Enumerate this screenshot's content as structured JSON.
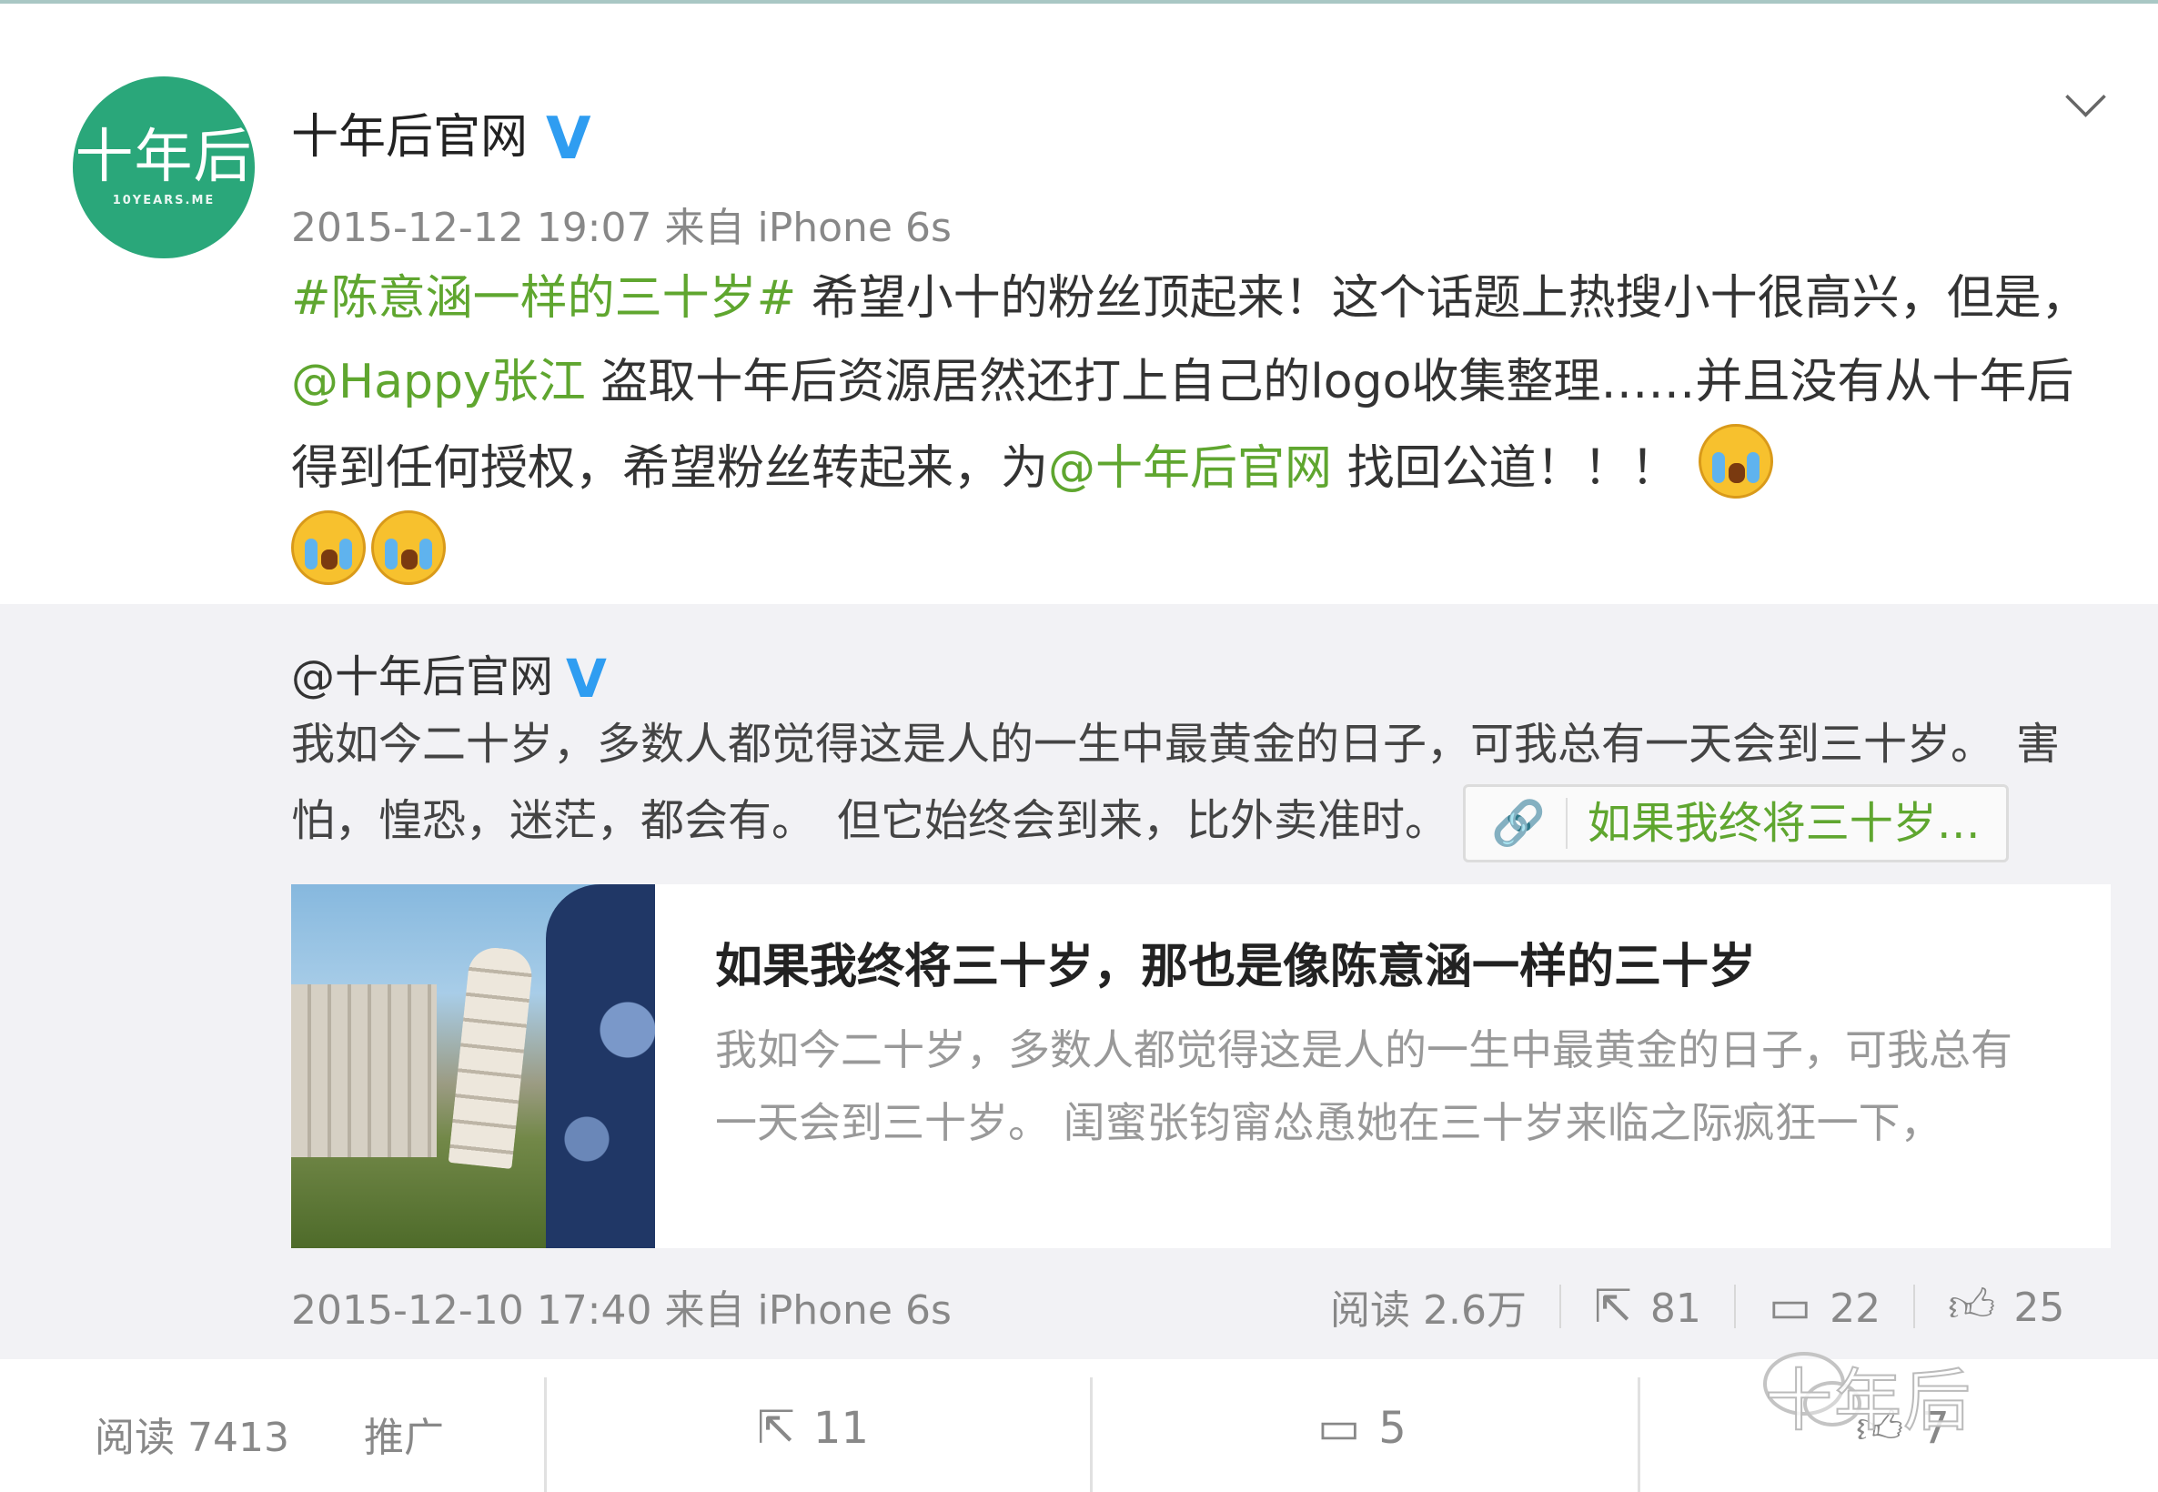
{
  "post": {
    "avatar_text": "十年后",
    "avatar_sub": "10YEARS.ME",
    "username": "十年后官网",
    "verified_mark": "V",
    "time": "2015-12-12 19:07",
    "source": "来自 iPhone 6s",
    "topic": "#陈意涵一样的三十岁#",
    "text_1": " 希望小十的粉丝顶起来！这个话题上热搜小十很高兴，但是，",
    "mention_1": "@Happy张江",
    "text_2": " 盗取十年后资源居然还打上自己的logo收集整理……并且没有从十年后得到任何授权，希望粉丝转起来，为",
    "mention_2": "@十年后官网",
    "text_3": " 找回公道！！！"
  },
  "repost": {
    "username": "@十年后官网",
    "verified_mark": "V",
    "text": "我如今二十岁，多数人都觉得这是人的一生中最黄金的日子，可我总有一天会到三十岁。　害怕，惶恐，迷茫，都会有。　但它始终会到来，比外卖准时。",
    "link_icon": "🔗",
    "link_label": "如果我终将三十岁…",
    "article_title": "如果我终将三十岁，那也是像陈意涵一样的三十岁",
    "article_desc": "我如今二十岁，多数人都觉得这是人的一生中最黄金的日子，可我总有一天会到三十岁。 闺蜜张钧甯怂恿她在三十岁来临之际疯狂一下，",
    "time": "2015-12-10 17:40",
    "source": "来自 iPhone 6s",
    "read_label": "阅读 2.6万",
    "share_count": "81",
    "comment_count": "22",
    "like_count": "25"
  },
  "bottom": {
    "read_label": "阅读 7413",
    "promote_label": "推广",
    "share_count": "11",
    "comment_count": "5",
    "like_count": "7"
  },
  "watermark": "十年后",
  "icons": {
    "menu": "chevron-down-icon",
    "share": "share-icon",
    "comment": "comment-icon",
    "like": "thumbs-up-icon",
    "link": "link-icon",
    "emoji": "crying-face-icon"
  },
  "colors": {
    "brand_green": "#2aa77a",
    "link_green": "#5fa62f",
    "verified_blue": "#2f9df1"
  }
}
